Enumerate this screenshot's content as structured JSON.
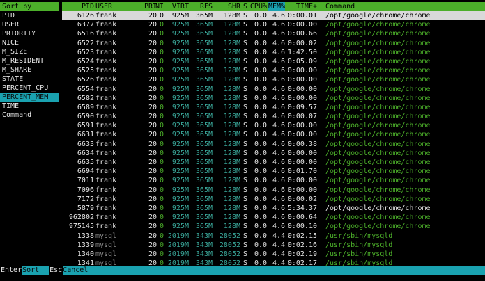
{
  "sidebar": {
    "header": "Sort by",
    "items": [
      "PID",
      "USER",
      "PRIORITY",
      "NICE",
      "M_SIZE",
      "M_RESIDENT",
      "M_SHARE",
      "STATE",
      "PERCENT_CPU",
      "PERCENT_MEM",
      "TIME",
      "Command"
    ],
    "selected": "PERCENT_MEM"
  },
  "columns": {
    "pid": "PID",
    "user": "USER",
    "pri": "PRI",
    "ni": "NI",
    "virt": "VIRT",
    "res": "RES",
    "shr": "SHR",
    "s": "S",
    "cpu": "CPU%",
    "mem": "MEM%",
    "time": "TIME+",
    "cmd": "Command"
  },
  "processes": [
    {
      "pid": "6126",
      "user": "frank",
      "pri": "20",
      "ni": "0",
      "virt": "925M",
      "res": "365M",
      "shr": "128M",
      "s": "S",
      "cpu": "0.0",
      "mem": "4.6",
      "time": "0:00.01",
      "cmd": "/opt/google/chrome/chrome"
    },
    {
      "pid": "6377",
      "user": "frank",
      "pri": "20",
      "ni": "0",
      "virt": "925M",
      "res": "365M",
      "shr": "128M",
      "s": "S",
      "cpu": "0.0",
      "mem": "4.6",
      "time": "0:00.00",
      "cmd": "/opt/google/chrome/chrome"
    },
    {
      "pid": "6516",
      "user": "frank",
      "pri": "20",
      "ni": "0",
      "virt": "925M",
      "res": "365M",
      "shr": "128M",
      "s": "S",
      "cpu": "0.0",
      "mem": "4.6",
      "time": "0:00.66",
      "cmd": "/opt/google/chrome/chrome"
    },
    {
      "pid": "6522",
      "user": "frank",
      "pri": "20",
      "ni": "0",
      "virt": "925M",
      "res": "365M",
      "shr": "128M",
      "s": "S",
      "cpu": "0.0",
      "mem": "4.6",
      "time": "0:00.02",
      "cmd": "/opt/google/chrome/chrome"
    },
    {
      "pid": "6523",
      "user": "frank",
      "pri": "20",
      "ni": "0",
      "virt": "925M",
      "res": "365M",
      "shr": "128M",
      "s": "S",
      "cpu": "0.0",
      "mem": "4.6",
      "time": "1:42.50",
      "cmd": "/opt/google/chrome/chrome"
    },
    {
      "pid": "6524",
      "user": "frank",
      "pri": "20",
      "ni": "0",
      "virt": "925M",
      "res": "365M",
      "shr": "128M",
      "s": "S",
      "cpu": "0.0",
      "mem": "4.6",
      "time": "0:05.09",
      "cmd": "/opt/google/chrome/chrome"
    },
    {
      "pid": "6525",
      "user": "frank",
      "pri": "20",
      "ni": "0",
      "virt": "925M",
      "res": "365M",
      "shr": "128M",
      "s": "S",
      "cpu": "0.0",
      "mem": "4.6",
      "time": "0:00.00",
      "cmd": "/opt/google/chrome/chrome"
    },
    {
      "pid": "6526",
      "user": "frank",
      "pri": "20",
      "ni": "0",
      "virt": "925M",
      "res": "365M",
      "shr": "128M",
      "s": "S",
      "cpu": "0.0",
      "mem": "4.6",
      "time": "0:00.00",
      "cmd": "/opt/google/chrome/chrome"
    },
    {
      "pid": "6554",
      "user": "frank",
      "pri": "20",
      "ni": "0",
      "virt": "925M",
      "res": "365M",
      "shr": "128M",
      "s": "S",
      "cpu": "0.0",
      "mem": "4.6",
      "time": "0:00.00",
      "cmd": "/opt/google/chrome/chrome"
    },
    {
      "pid": "6582",
      "user": "frank",
      "pri": "20",
      "ni": "0",
      "virt": "925M",
      "res": "365M",
      "shr": "128M",
      "s": "S",
      "cpu": "0.0",
      "mem": "4.6",
      "time": "0:00.00",
      "cmd": "/opt/google/chrome/chrome"
    },
    {
      "pid": "6589",
      "user": "frank",
      "pri": "20",
      "ni": "0",
      "virt": "925M",
      "res": "365M",
      "shr": "128M",
      "s": "S",
      "cpu": "0.0",
      "mem": "4.6",
      "time": "0:09.57",
      "cmd": "/opt/google/chrome/chrome"
    },
    {
      "pid": "6590",
      "user": "frank",
      "pri": "20",
      "ni": "0",
      "virt": "925M",
      "res": "365M",
      "shr": "128M",
      "s": "S",
      "cpu": "0.0",
      "mem": "4.6",
      "time": "0:00.07",
      "cmd": "/opt/google/chrome/chrome"
    },
    {
      "pid": "6591",
      "user": "frank",
      "pri": "20",
      "ni": "0",
      "virt": "925M",
      "res": "365M",
      "shr": "128M",
      "s": "S",
      "cpu": "0.0",
      "mem": "4.6",
      "time": "0:00.00",
      "cmd": "/opt/google/chrome/chrome"
    },
    {
      "pid": "6631",
      "user": "frank",
      "pri": "20",
      "ni": "0",
      "virt": "925M",
      "res": "365M",
      "shr": "128M",
      "s": "S",
      "cpu": "0.0",
      "mem": "4.6",
      "time": "0:00.00",
      "cmd": "/opt/google/chrome/chrome"
    },
    {
      "pid": "6633",
      "user": "frank",
      "pri": "20",
      "ni": "0",
      "virt": "925M",
      "res": "365M",
      "shr": "128M",
      "s": "S",
      "cpu": "0.0",
      "mem": "4.6",
      "time": "0:00.38",
      "cmd": "/opt/google/chrome/chrome"
    },
    {
      "pid": "6634",
      "user": "frank",
      "pri": "20",
      "ni": "0",
      "virt": "925M",
      "res": "365M",
      "shr": "128M",
      "s": "S",
      "cpu": "0.0",
      "mem": "4.6",
      "time": "0:00.00",
      "cmd": "/opt/google/chrome/chrome"
    },
    {
      "pid": "6635",
      "user": "frank",
      "pri": "20",
      "ni": "0",
      "virt": "925M",
      "res": "365M",
      "shr": "128M",
      "s": "S",
      "cpu": "0.0",
      "mem": "4.6",
      "time": "0:00.00",
      "cmd": "/opt/google/chrome/chrome"
    },
    {
      "pid": "6694",
      "user": "frank",
      "pri": "20",
      "ni": "0",
      "virt": "925M",
      "res": "365M",
      "shr": "128M",
      "s": "S",
      "cpu": "0.0",
      "mem": "4.6",
      "time": "0:01.70",
      "cmd": "/opt/google/chrome/chrome"
    },
    {
      "pid": "7011",
      "user": "frank",
      "pri": "20",
      "ni": "0",
      "virt": "925M",
      "res": "365M",
      "shr": "128M",
      "s": "S",
      "cpu": "0.0",
      "mem": "4.6",
      "time": "0:00.00",
      "cmd": "/opt/google/chrome/chrome"
    },
    {
      "pid": "7096",
      "user": "frank",
      "pri": "20",
      "ni": "0",
      "virt": "925M",
      "res": "365M",
      "shr": "128M",
      "s": "S",
      "cpu": "0.0",
      "mem": "4.6",
      "time": "0:00.00",
      "cmd": "/opt/google/chrome/chrome"
    },
    {
      "pid": "7172",
      "user": "frank",
      "pri": "20",
      "ni": "0",
      "virt": "925M",
      "res": "365M",
      "shr": "128M",
      "s": "S",
      "cpu": "0.0",
      "mem": "4.6",
      "time": "0:00.02",
      "cmd": "/opt/google/chrome/chrome"
    },
    {
      "pid": "5879",
      "user": "frank",
      "pri": "20",
      "ni": "0",
      "virt": "925M",
      "res": "365M",
      "shr": "128M",
      "s": "S",
      "cpu": "0.0",
      "mem": "4.6",
      "time": "5:34.37",
      "cmd": "/opt/google/chrome/chrome"
    },
    {
      "pid": "962802",
      "user": "frank",
      "pri": "20",
      "ni": "0",
      "virt": "925M",
      "res": "365M",
      "shr": "128M",
      "s": "S",
      "cpu": "0.0",
      "mem": "4.6",
      "time": "0:00.64",
      "cmd": "/opt/google/chrome/chrome"
    },
    {
      "pid": "975145",
      "user": "frank",
      "pri": "20",
      "ni": "0",
      "virt": "925M",
      "res": "365M",
      "shr": "128M",
      "s": "S",
      "cpu": "0.0",
      "mem": "4.6",
      "time": "0:00.10",
      "cmd": "/opt/google/chrome/chrome"
    },
    {
      "pid": "1338",
      "user": "mysql",
      "pri": "20",
      "ni": "0",
      "virt": "2019M",
      "res": "343M",
      "shr": "28052",
      "s": "S",
      "cpu": "0.0",
      "mem": "4.4",
      "time": "0:02.15",
      "cmd": "/usr/sbin/mysqld"
    },
    {
      "pid": "1339",
      "user": "mysql",
      "pri": "20",
      "ni": "0",
      "virt": "2019M",
      "res": "343M",
      "shr": "28052",
      "s": "S",
      "cpu": "0.0",
      "mem": "4.4",
      "time": "0:02.16",
      "cmd": "/usr/sbin/mysqld"
    },
    {
      "pid": "1340",
      "user": "mysql",
      "pri": "20",
      "ni": "0",
      "virt": "2019M",
      "res": "343M",
      "shr": "28052",
      "s": "S",
      "cpu": "0.0",
      "mem": "4.4",
      "time": "0:02.19",
      "cmd": "/usr/sbin/mysqld"
    },
    {
      "pid": "1341",
      "user": "mysql",
      "pri": "20",
      "ni": "0",
      "virt": "2019M",
      "res": "343M",
      "shr": "28052",
      "s": "S",
      "cpu": "0.0",
      "mem": "4.4",
      "time": "0:02.17",
      "cmd": "/usr/sbin/mysqld"
    }
  ],
  "selected_row": 0,
  "footer": [
    {
      "key": "Enter",
      "label": "Sort"
    },
    {
      "key": "Esc",
      "label": "Cancel"
    }
  ],
  "colors": {
    "header_green": "#4caf2a",
    "selection_cyan": "#1aa2b0",
    "data_teal": "#3aa89a"
  }
}
